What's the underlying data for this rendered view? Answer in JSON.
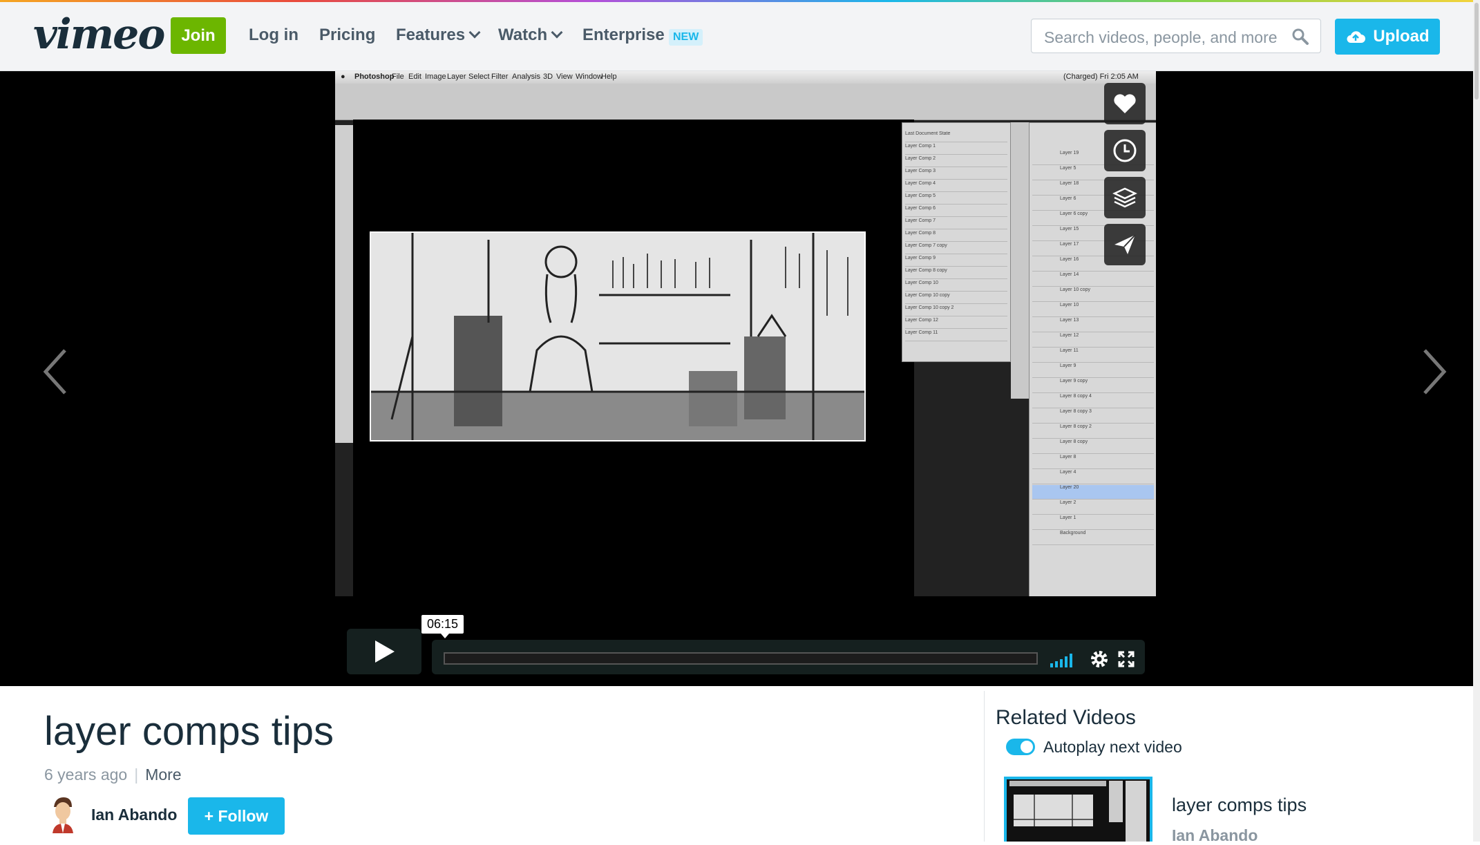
{
  "header": {
    "logo": "vimeo",
    "join_label": "Join",
    "nav": [
      {
        "label": "Log in"
      },
      {
        "label": "Pricing"
      },
      {
        "label": "Features"
      },
      {
        "label": "Watch"
      },
      {
        "label": "Enterprise"
      }
    ],
    "new_badge": "NEW",
    "search_placeholder": "Search videos, people, and more",
    "upload_label": "Upload"
  },
  "screen_capture": {
    "menubar": [
      "Photoshop",
      "File",
      "Edit",
      "Image",
      "Layer",
      "Select",
      "Filter",
      "Analysis",
      "3D",
      "View",
      "Window",
      "Help"
    ],
    "status_text": "(Charged) Fri 2:05 AM",
    "layer_comps": [
      "Last Document State",
      "Layer Comp 1",
      "Layer Comp 2",
      "Layer Comp 3",
      "Layer Comp 4",
      "Layer Comp 5",
      "Layer Comp 6",
      "Layer Comp 7",
      "Layer Comp 8",
      "Layer Comp 7 copy",
      "Layer Comp 9",
      "Layer Comp 8 copy",
      "Layer Comp 10",
      "Layer Comp 10 copy",
      "Layer Comp 10 copy 2",
      "Layer Comp 12",
      "Layer Comp 11"
    ],
    "layers": [
      "Layer 19",
      "Layer 5",
      "Layer 18",
      "Layer 6",
      "Layer 6 copy",
      "Layer 15",
      "Layer 17",
      "Layer 16",
      "Layer 14",
      "Layer 10 copy",
      "Layer 10",
      "Layer 13",
      "Layer 12",
      "Layer 11",
      "Layer 9",
      "Layer 9 copy",
      "Layer 8 copy 4",
      "Layer 8 copy 3",
      "Layer 8 copy 2",
      "Layer 8 copy",
      "Layer 8",
      "Layer 4",
      "Layer 20",
      "Layer 2",
      "Layer 1",
      "Background"
    ],
    "selected_layer": "Layer 20"
  },
  "player": {
    "current_time": "06:15",
    "progress": 0
  },
  "video": {
    "title": "layer comps tips",
    "age": "6 years ago",
    "more_label": "More",
    "author": "Ian Abando",
    "follow_label": "+ Follow"
  },
  "related": {
    "heading": "Related Videos",
    "autoplay_label": "Autoplay next video",
    "autoplay_on": true,
    "items": [
      {
        "title": "layer comps tips",
        "author": "Ian Abando"
      }
    ]
  },
  "colors": {
    "accent": "#1ab7ea",
    "join_green": "#6cb600",
    "text_dark": "#1a2e3b",
    "text_muted": "#8a96a0"
  }
}
